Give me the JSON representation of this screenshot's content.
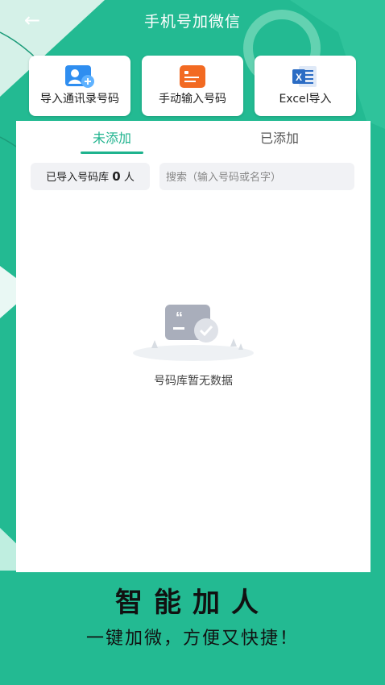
{
  "header": {
    "back_label": "←",
    "title": "手机号加微信"
  },
  "cards": [
    {
      "label": "导入通讯录号码",
      "icon": "contacts-import-icon"
    },
    {
      "label": "手动输入号码",
      "icon": "manual-input-icon"
    },
    {
      "label": "Excel导入",
      "icon": "excel-icon",
      "icon_letter": "X"
    }
  ],
  "tabs": {
    "active": "未添加",
    "inactive": "已添加"
  },
  "library": {
    "count_prefix": "已导入号码库",
    "count_value": "0",
    "count_suffix": "人"
  },
  "search": {
    "placeholder": "搜索（输入号码或名字）"
  },
  "empty": {
    "text": "号码库暂无数据"
  },
  "slogan": {
    "main": "智能加人",
    "sub": "一键加微，方便又快捷！"
  },
  "colors": {
    "brand": "#23ba92",
    "accent": "#1fb38e"
  }
}
